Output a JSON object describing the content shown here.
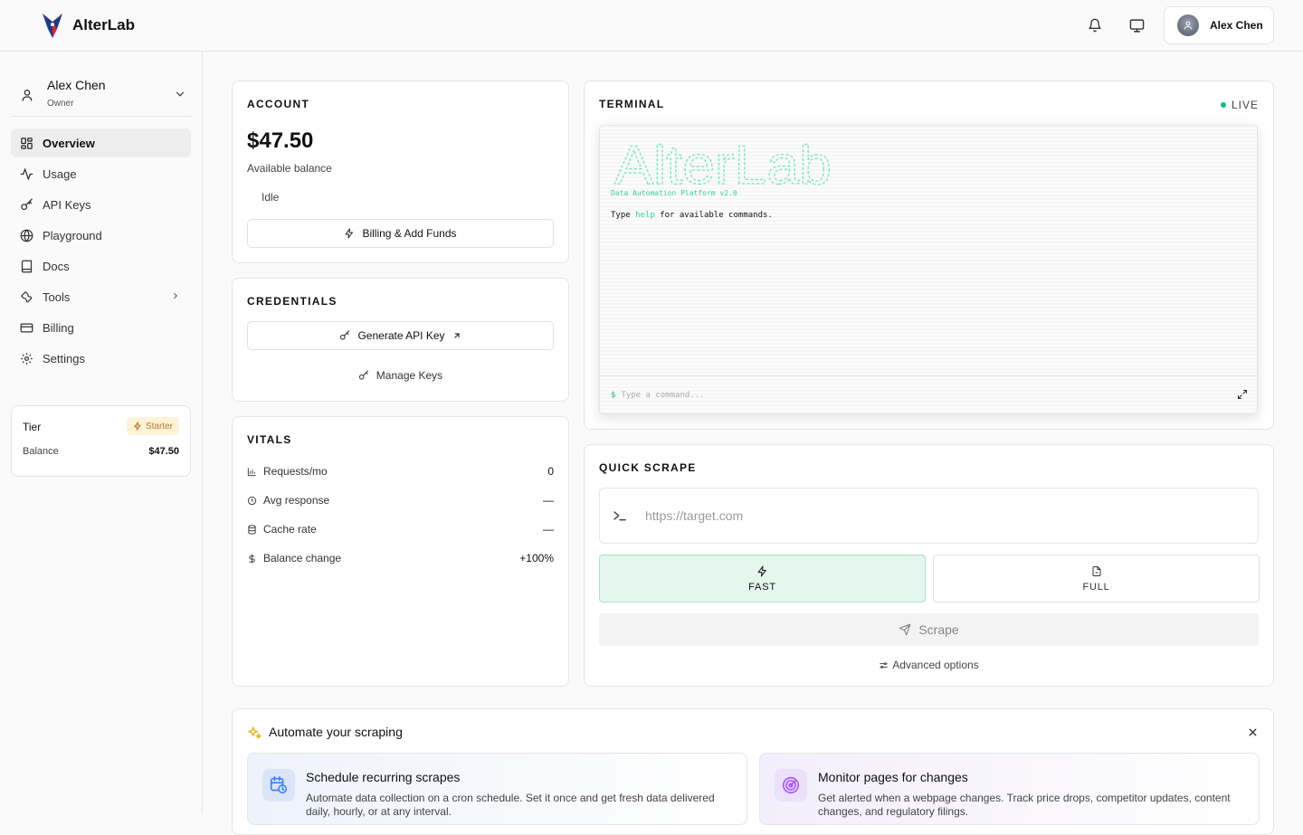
{
  "app": {
    "name": "AlterLab"
  },
  "header": {
    "user_name": "Alex Chen"
  },
  "sidebar": {
    "profile": {
      "name": "Alex Chen",
      "role": "Owner"
    },
    "items": [
      {
        "label": "Overview",
        "icon": "grid-icon",
        "active": true
      },
      {
        "label": "Usage",
        "icon": "activity-icon"
      },
      {
        "label": "API Keys",
        "icon": "key-icon"
      },
      {
        "label": "Playground",
        "icon": "globe-icon"
      },
      {
        "label": "Docs",
        "icon": "book-icon"
      },
      {
        "label": "Tools",
        "icon": "wrench-icon",
        "has_submenu": true
      },
      {
        "label": "Billing",
        "icon": "credit-card-icon"
      },
      {
        "label": "Settings",
        "icon": "gear-icon"
      }
    ],
    "tier": {
      "label": "Tier",
      "badge": "Starter",
      "balance_label": "Balance",
      "balance_value": "$47.50"
    }
  },
  "account": {
    "title": "ACCOUNT",
    "balance": "$47.50",
    "balance_label": "Available balance",
    "status": "Idle",
    "billing_button": "Billing & Add Funds"
  },
  "credentials": {
    "title": "CREDENTIALS",
    "generate_button": "Generate API Key",
    "manage_link": "Manage Keys"
  },
  "vitals": {
    "title": "VITALS",
    "rows": [
      {
        "label": "Requests/mo",
        "value": "0"
      },
      {
        "label": "Avg response",
        "value": "—"
      },
      {
        "label": "Cache rate",
        "value": "—"
      },
      {
        "label": "Balance change",
        "value": "+100%"
      }
    ]
  },
  "terminal": {
    "title": "TERMINAL",
    "live": "LIVE",
    "banner": "AlterLab",
    "tagline": "Data Automation Platform v2.0",
    "line_pre": "Type ",
    "line_kw": "help",
    "line_post": " for available commands.",
    "prompt": "$",
    "placeholder": "Type a command..."
  },
  "quick_scrape": {
    "title": "QUICK SCRAPE",
    "url_placeholder": "https://target.com",
    "modes": [
      {
        "label": "FAST",
        "selected": true
      },
      {
        "label": "FULL",
        "selected": false
      }
    ],
    "scrape_button": "Scrape",
    "advanced": "Advanced options"
  },
  "automate": {
    "title": "Automate your scraping",
    "features": [
      {
        "title": "Schedule recurring scrapes",
        "desc": "Automate data collection on a cron schedule. Set it once and get fresh data delivered daily, hourly, or at any interval."
      },
      {
        "title": "Monitor pages for changes",
        "desc": "Get alerted when a webpage changes. Track price drops, competitor updates, content changes, and regulatory filings."
      }
    ]
  },
  "colors": {
    "accent": "#10b981",
    "tier_badge": "#b7791f",
    "selected_mode_bg": "#e5f6ef"
  }
}
